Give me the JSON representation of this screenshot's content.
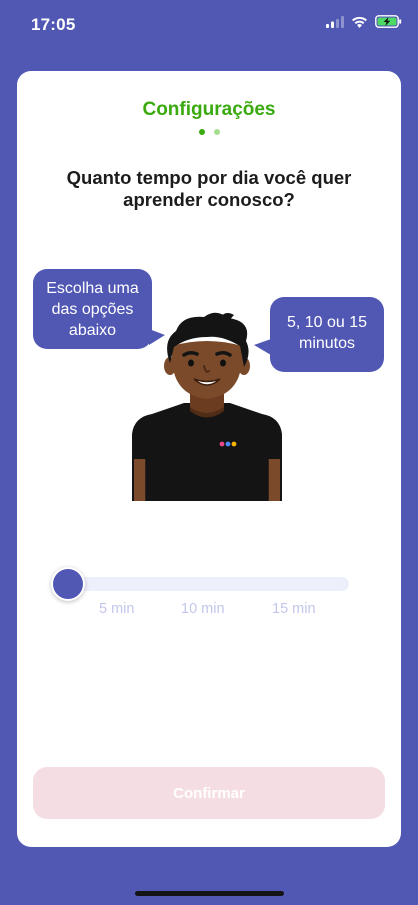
{
  "status_bar": {
    "time": "17:05",
    "icons": [
      "signal-icon",
      "wifi-icon",
      "battery-charging-icon"
    ]
  },
  "card": {
    "title": "Configurações",
    "progress": {
      "steps": 2,
      "current": 1
    },
    "question": "Quanto tempo por dia você quer aprender conosco?",
    "bubbles": {
      "left": "Escolha uma das opções abaixo",
      "right": "5, 10 ou 15 minutos"
    },
    "slider": {
      "options": [
        "5 min",
        "10 min",
        "15 min"
      ],
      "value_fraction": 0
    },
    "confirm_label": "Confirmar"
  },
  "colors": {
    "background": "#5158B4",
    "title_green": "#3AAA0E",
    "bubble": "#5158B4",
    "slider_track": "#EDEFFC",
    "slider_label": "#C3C6EC",
    "confirm_disabled_bg": "#F5DEE3"
  }
}
